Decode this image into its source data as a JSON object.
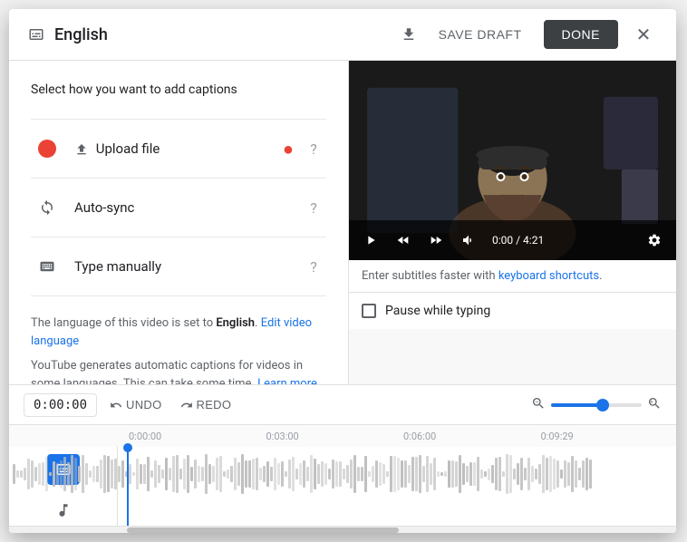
{
  "modal": {
    "title": "English",
    "header_icon": "subtitles",
    "save_draft_label": "SAVE DRAFT",
    "done_label": "DONE"
  },
  "left_panel": {
    "select_caption_text": "Select how you want to add captions",
    "options": [
      {
        "id": "upload",
        "label": "Upload file",
        "icon": "upload",
        "has_dot": true
      },
      {
        "id": "autosync",
        "label": "Auto-sync",
        "icon": "auto-sync"
      },
      {
        "id": "manual",
        "label": "Type manually",
        "icon": "keyboard"
      }
    ],
    "language_info": {
      "line1_prefix": "The language of this video is set to ",
      "language": "English",
      "line1_suffix": ".",
      "edit_link": "Edit video language",
      "line2": "YouTube generates automatic captions for videos in some languages. This can take some time.",
      "learn_more_link": "Learn more"
    }
  },
  "right_panel": {
    "video": {
      "time_current": "0:00",
      "time_total": "4:21"
    },
    "subtitles_hint": {
      "text": "Enter subtitles faster with ",
      "link_text": "keyboard shortcuts",
      "suffix": "."
    },
    "pause_typing": {
      "label": "Pause while typing",
      "checked": false
    }
  },
  "toolbar": {
    "timecode": "0:00:00",
    "undo_label": "UNDO",
    "redo_label": "REDO",
    "zoom_min_icon": "zoom-out",
    "zoom_max_icon": "zoom-in",
    "zoom_value": 60
  },
  "timeline": {
    "time_marks": [
      "0:00:00",
      "0:03:00",
      "0:06:00",
      "0:09:29"
    ]
  }
}
